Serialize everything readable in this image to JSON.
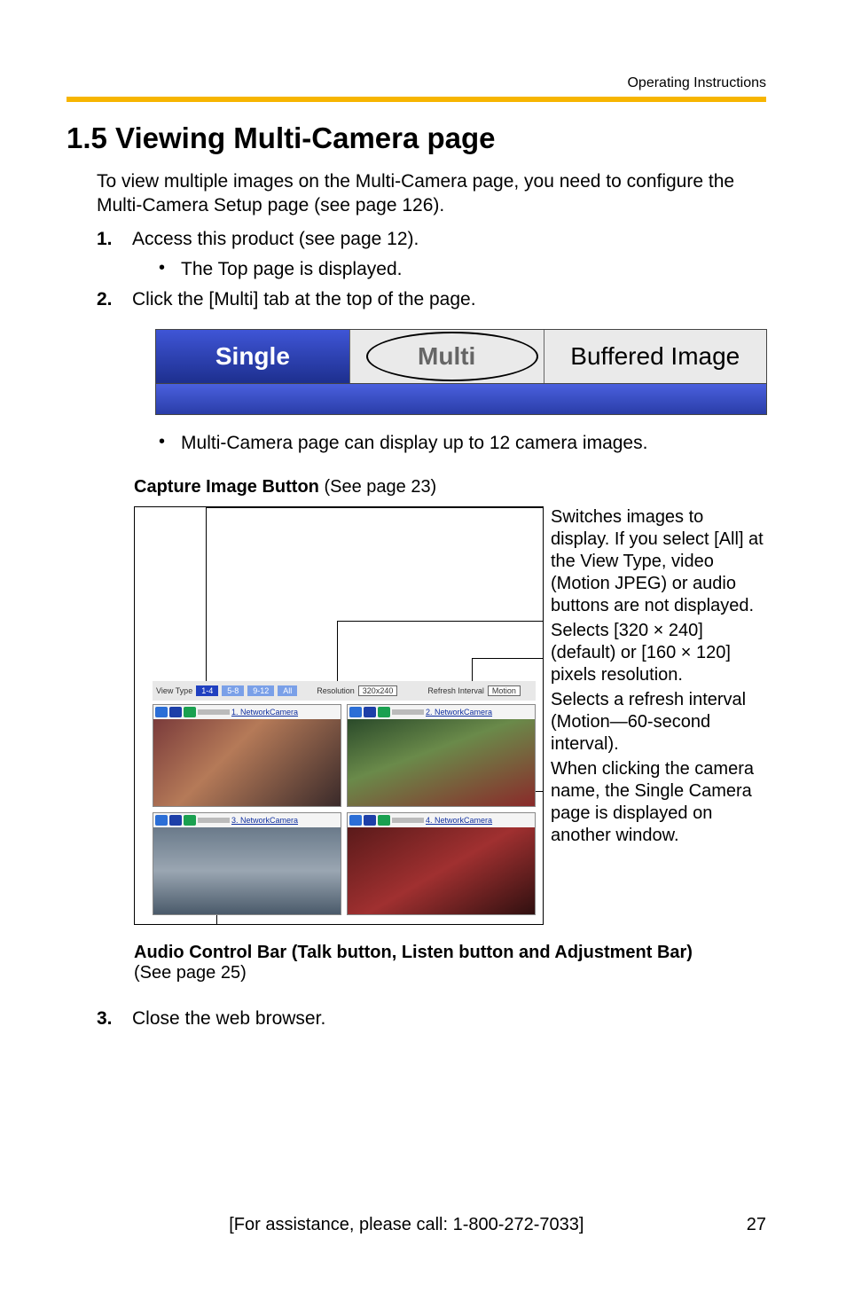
{
  "header": {
    "running_head": "Operating Instructions"
  },
  "title": "1.5    Viewing Multi-Camera page",
  "intro": "To view multiple images on the Multi-Camera page, you need to configure the Multi-Camera Setup page (see page 126).",
  "steps": {
    "s1_num": "1.",
    "s1_text": "Access this product (see page 12).",
    "s1_sub": "The Top page is displayed.",
    "s2_num": "2.",
    "s2_text": "Click the [Multi] tab at the top of the page.",
    "s2_sub": "Multi-Camera page can display up to 12 camera images.",
    "s3_num": "3.",
    "s3_text": "Close the web browser."
  },
  "tabs": {
    "single": "Single",
    "multi": "Multi",
    "buffered": "Buffered Image"
  },
  "fig1": {
    "caption_bold": "Capture Image Button",
    "caption_rest": " (See page 23)",
    "toolbar": {
      "viewtype_label": "View Type",
      "b1": "1-4",
      "b2": "5-8",
      "b3": "9-12",
      "b4": "All",
      "res_label": "Resolution",
      "res_val": "320x240",
      "ref_label": "Refresh Interval",
      "ref_val": "Motion"
    },
    "cams": {
      "c1": "1. NetworkCamera",
      "c2": "2. NetworkCamera",
      "c3": "3. NetworkCamera",
      "c4": "4. NetworkCamera"
    }
  },
  "callouts": {
    "c1": "Switches images to display. If you select [All] at the View Type, video (Motion JPEG) or audio buttons are not displayed.",
    "c2": "Selects [320 × 240] (default) or [160 × 120] pixels resolution.",
    "c3": "Selects a refresh interval (Motion—60-second interval).",
    "c4": "When clicking the camera name, the Single Camera page is displayed on another window."
  },
  "audio_caption": {
    "bold": "Audio Control Bar (Talk button, Listen button and Adjustment Bar)",
    "rest": "(See page 25)"
  },
  "footer": {
    "assist": "[For assistance, please call: 1-800-272-7033]",
    "pageno": "27"
  }
}
